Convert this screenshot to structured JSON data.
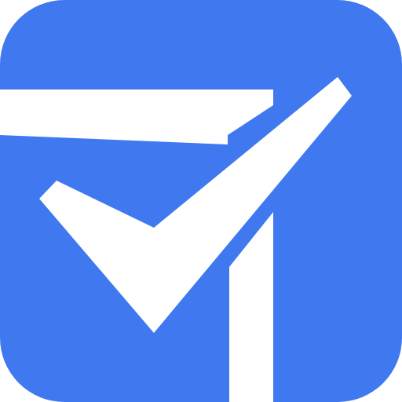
{
  "icon": {
    "name": "checklist-app-icon",
    "colors": {
      "tile": "#4078F0",
      "mark": "#FFFFFF",
      "background": "#FFFFFF"
    }
  }
}
